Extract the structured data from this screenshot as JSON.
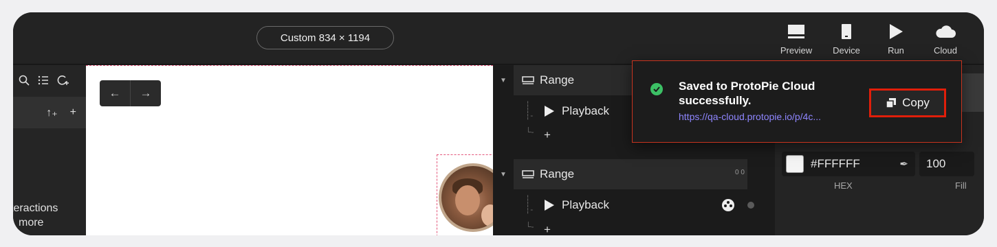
{
  "topbar": {
    "device_label": "Custom  834 × 1194",
    "buttons": [
      {
        "label": "Preview",
        "icon": "preview-icon"
      },
      {
        "label": "Device",
        "icon": "device-icon"
      },
      {
        "label": "Run",
        "icon": "run-icon"
      },
      {
        "label": "Cloud",
        "icon": "cloud-icon"
      }
    ]
  },
  "left_panel": {
    "bottom_line1": "teractions",
    "bottom_line2": "more"
  },
  "timeline": {
    "groups": [
      {
        "title": "Range",
        "response": "Playback",
        "add": "+"
      },
      {
        "title": "Range",
        "response": "Playback",
        "add": "+"
      }
    ],
    "ruler": "0    0"
  },
  "properties": {
    "hex_value": "#FFFFFF",
    "fill_value": "100",
    "hex_label": "HEX",
    "fill_label": "Fill"
  },
  "toast": {
    "title": "Saved to ProtoPie Cloud successfully.",
    "link": "https://qa-cloud.protopie.io/p/4c...",
    "copy_label": "Copy"
  }
}
